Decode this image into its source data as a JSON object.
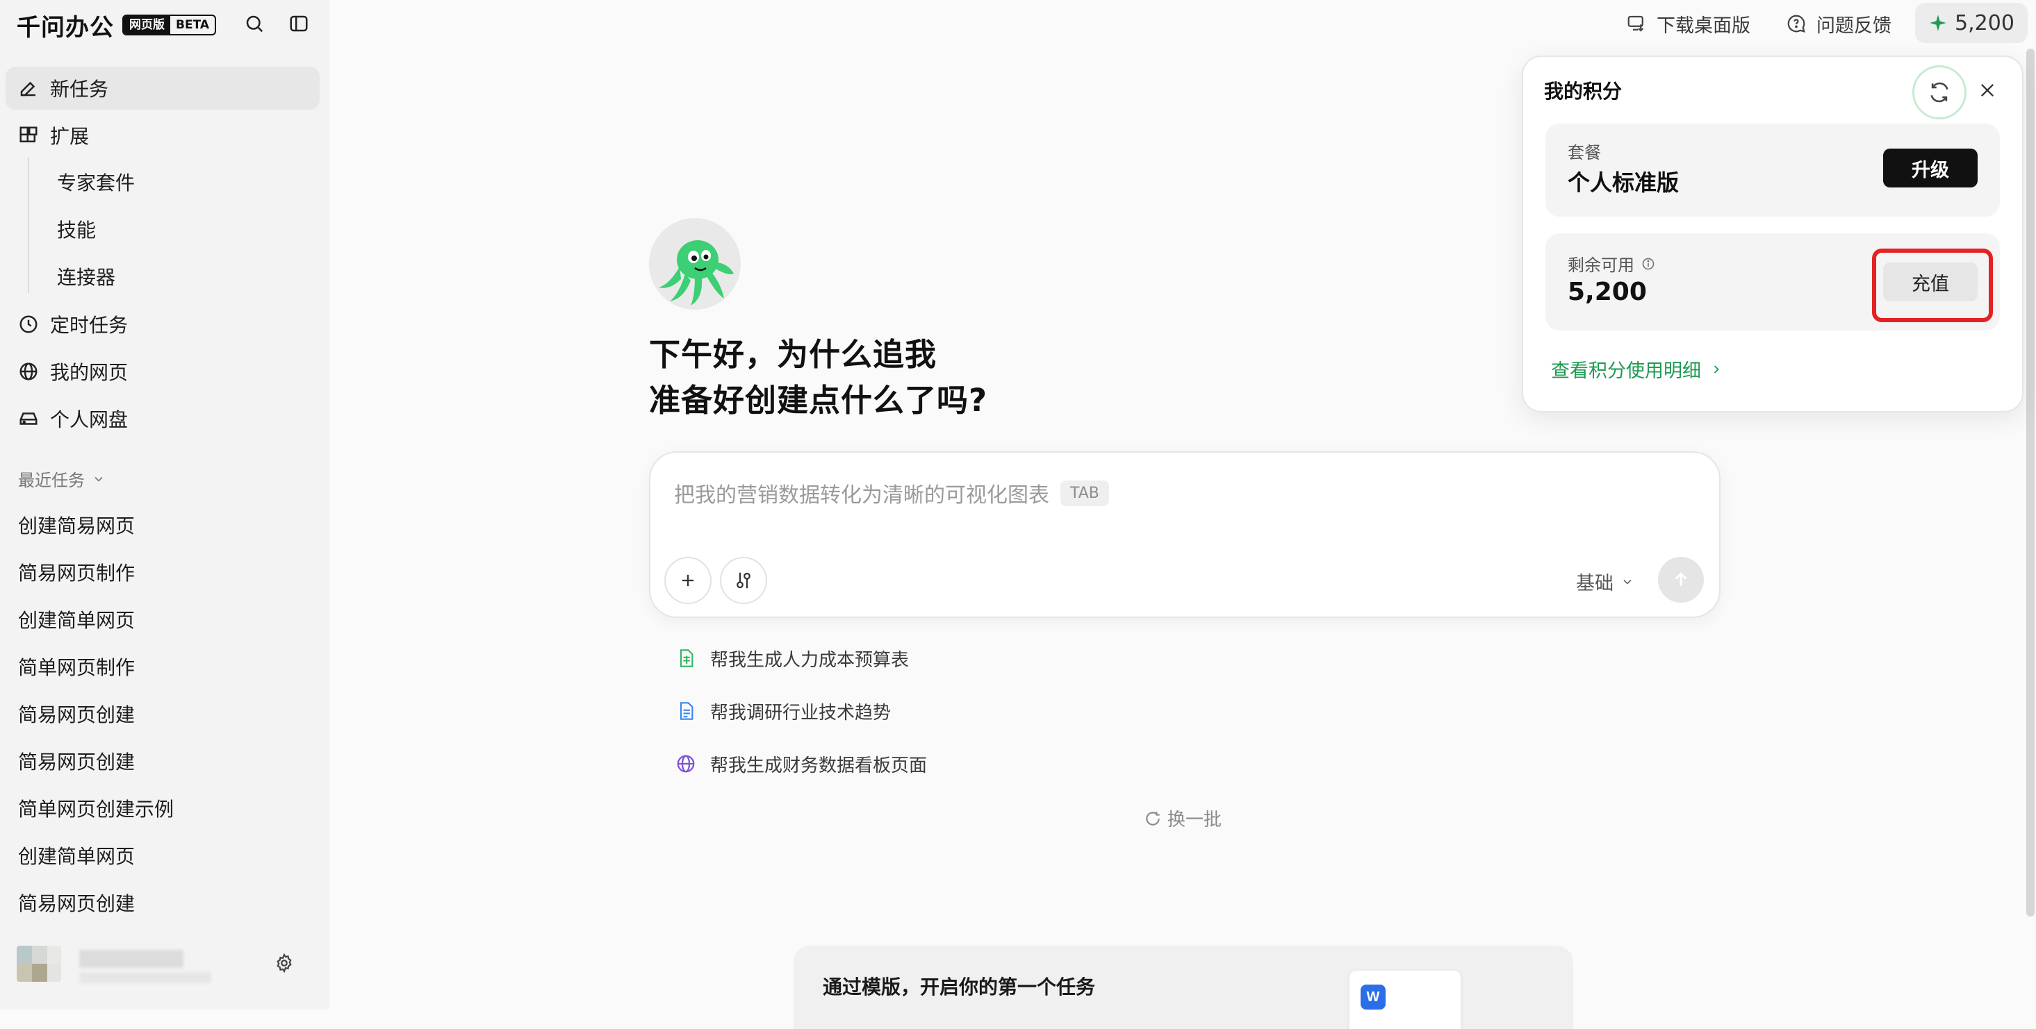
{
  "app": {
    "name": "千问办公",
    "badge_left": "网页版",
    "badge_right": "BETA"
  },
  "sidebar": {
    "new_task": "新任务",
    "extensions": "扩展",
    "ext_items": [
      "专家套件",
      "技能",
      "连接器"
    ],
    "scheduled": "定时任务",
    "my_pages": "我的网页",
    "drive": "个人网盘",
    "recent_title": "最近任务",
    "recent": [
      "创建简易网页",
      "简易网页制作",
      "创建简单网页",
      "简单网页制作",
      "简易网页创建",
      "简易网页创建",
      "简单网页创建示例",
      "创建简单网页",
      "简易网页创建"
    ]
  },
  "topbar": {
    "download": "下载桌面版",
    "feedback": "问题反馈",
    "points": "5,200"
  },
  "main": {
    "greeting_line1": "下午好，为什么追我",
    "greeting_line2": "准备好创建点什么了吗?",
    "input_placeholder": "把我的营销数据转化为清晰的可视化图表",
    "tab_hint": "TAB",
    "mode": "基础",
    "suggestions": [
      "帮我生成人力成本预算表",
      "帮我调研行业技术趋势",
      "帮我生成财务数据看板页面"
    ],
    "refresh": "换一批",
    "template_title": "通过模版，开启你的第一个任务",
    "word_letter": "W"
  },
  "popover": {
    "title": "我的积分",
    "plan_label": "套餐",
    "plan_value": "个人标准版",
    "upgrade": "升级",
    "remaining_label": "剩余可用",
    "remaining_value": "5,200",
    "recharge": "充值",
    "details_link": "查看积分使用明细"
  },
  "colors": {
    "accent_green": "#1e9b52",
    "highlight_red": "#e42222",
    "brand_dark": "#111111"
  }
}
